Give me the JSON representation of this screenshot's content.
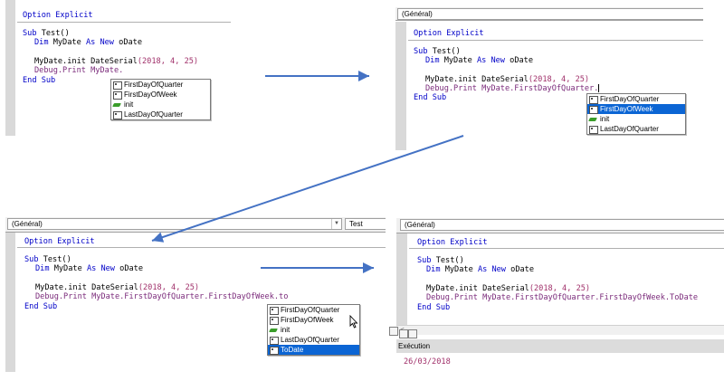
{
  "panel1": {
    "code": {
      "option_explicit": "Option Explicit",
      "sub_kw": "Sub",
      "sub_name": " Test()",
      "dim_kw": "Dim",
      "dim_mid": " MyDate ",
      "as_new": "As New",
      "dim_type": " oDate",
      "init_pre": "MyDate.init DateSerial",
      "init_args": "(2018, 4, 25)",
      "debug_line": "Debug.Print MyDate.",
      "end_sub": "End Sub"
    },
    "popup": [
      "FirstDayOfQuarter",
      "FirstDayOfWeek",
      "init",
      "LastDayOfQuarter"
    ]
  },
  "panel2": {
    "combo_general": "(Général)",
    "code": {
      "option_explicit": "Option Explicit",
      "sub_kw": "Sub",
      "sub_name": " Test()",
      "dim_kw": "Dim",
      "dim_mid": " MyDate ",
      "as_new": "As New",
      "dim_type": " oDate",
      "init_pre": "MyDate.init DateSerial",
      "init_args": "(2018, 4, 25)",
      "debug_line": "Debug.Print MyDate.FirstDayOfQuarter.",
      "end_sub": "End Sub"
    },
    "popup": [
      "FirstDayOfQuarter",
      "FirstDayOfWeek",
      "init",
      "LastDayOfQuarter"
    ],
    "selected": "FirstDayOfWeek"
  },
  "panel3": {
    "combo_general": "(Général)",
    "combo_proc": "Test",
    "code": {
      "option_explicit": "Option Explicit",
      "sub_kw": "Sub",
      "sub_name": " Test()",
      "dim_kw": "Dim",
      "dim_mid": " MyDate ",
      "as_new": "As New",
      "dim_type": " oDate",
      "init_pre": "MyDate.init DateSerial",
      "init_args": "(2018, 4, 25)",
      "debug_line": "Debug.Print MyDate.FirstDayOfQuarter.FirstDayOfWeek.to",
      "end_sub": "End Sub"
    },
    "popup": [
      "FirstDayOfQuarter",
      "FirstDayOfWeek",
      "init",
      "LastDayOfQuarter",
      "ToDate"
    ],
    "selected": "ToDate"
  },
  "panel4": {
    "combo_general": "(Général)",
    "code": {
      "option_explicit": "Option Explicit",
      "sub_kw": "Sub",
      "sub_name": " Test()",
      "dim_kw": "Dim",
      "dim_mid": " MyDate ",
      "as_new": "As New",
      "dim_type": " oDate",
      "init_pre": "MyDate.init DateSerial",
      "init_args": "(2018, 4, 25)",
      "debug_line": "Debug.Print MyDate.FirstDayOfQuarter.FirstDayOfWeek.ToDate",
      "end_sub": "End Sub"
    },
    "scroll_arrow": "<"
  },
  "immediate": {
    "title": "Exécution",
    "output": "26/03/2018"
  },
  "colors": {
    "arrow": "#4472c4",
    "keyword": "#0000c8",
    "selection": "#0b65d4"
  }
}
